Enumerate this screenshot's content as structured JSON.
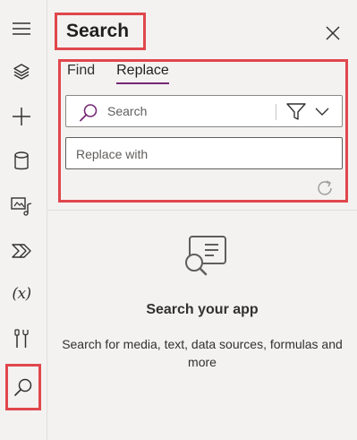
{
  "panel": {
    "title": "Search",
    "tabs": [
      {
        "label": "Find",
        "selected": false
      },
      {
        "label": "Replace",
        "selected": true
      }
    ],
    "search": {
      "placeholder": "Search"
    },
    "replace": {
      "placeholder": "Replace with"
    },
    "empty_state": {
      "title": "Search your app",
      "description_line1": "Search for media, text, data sources, formulas and",
      "description_line2": "more"
    }
  },
  "rail": {
    "items": [
      {
        "icon": "hamburger-icon"
      },
      {
        "icon": "layers-icon"
      },
      {
        "icon": "plus-icon"
      },
      {
        "icon": "database-icon"
      },
      {
        "icon": "media-icon"
      },
      {
        "icon": "power-automate-icon"
      },
      {
        "icon": "variables-icon",
        "glyph": "(x)"
      },
      {
        "icon": "tools-icon"
      },
      {
        "icon": "search-icon",
        "active": true
      }
    ]
  },
  "colors": {
    "accent": "#742774",
    "highlight_border": "#e0474c",
    "panel_bg": "#f3f2f1"
  }
}
